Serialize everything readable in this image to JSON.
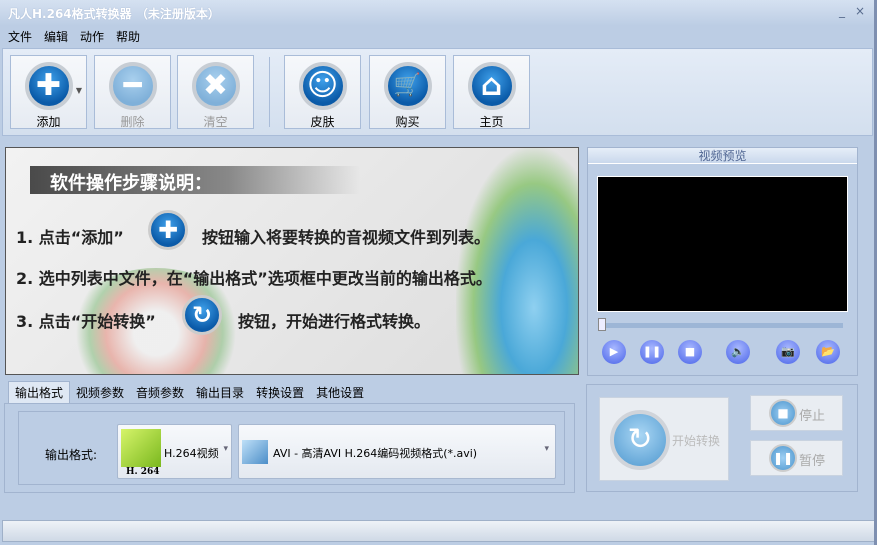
{
  "window": {
    "title": "凡人H.264格式转换器  （未注册版本）",
    "minimize": "_",
    "close": "×"
  },
  "menu": [
    "文件",
    "编辑",
    "动作",
    "帮助"
  ],
  "toolbar": [
    {
      "label": "添加",
      "icon": "plus-icon",
      "glyph": "✚",
      "enabled": true
    },
    {
      "label": "删除",
      "icon": "minus-icon",
      "glyph": "━",
      "enabled": false
    },
    {
      "label": "清空",
      "icon": "clear-x-icon",
      "glyph": "✖",
      "enabled": false
    },
    {
      "label": "皮肤",
      "icon": "smiley-icon",
      "glyph": "☺",
      "enabled": true
    },
    {
      "label": "购买",
      "icon": "cart-icon",
      "glyph": "🛒",
      "enabled": true
    },
    {
      "label": "主页",
      "icon": "home-icon",
      "glyph": "⌂",
      "enabled": true
    }
  ],
  "banner": {
    "heading": "软件操作步骤说明：",
    "step1a": "1. 点击“添加”",
    "step1b": "按钮输入将要转换的音视频文件到列表。",
    "step2": "2. 选中列表中文件，在“输出格式”选项框中更改当前的输出格式。",
    "step3a": "3. 点击“开始转换”",
    "step3b": "按钮，开始进行格式转换。",
    "plus": "✚",
    "arrow": "↻"
  },
  "preview": {
    "title": "视频预览",
    "progress": 0,
    "controls": [
      "▶",
      "❚❚",
      "■",
      "🔈",
      "📷",
      "📂"
    ]
  },
  "tabs": [
    "输出格式",
    "视频参数",
    "音频参数",
    "输出目录",
    "转换设置",
    "其他设置"
  ],
  "format": {
    "label": "输出格式:",
    "category": "H.264视频",
    "category_icon_text": "H. 264",
    "format": "AVI - 高清AVI H.264编码视频格式(*.avi)",
    "arrow": "▾"
  },
  "actions": {
    "start": "开始转换",
    "stop": "停止",
    "pause": "暂停",
    "start_glyph": "↻",
    "stop_glyph": "■",
    "pause_glyph": "❚❚"
  }
}
